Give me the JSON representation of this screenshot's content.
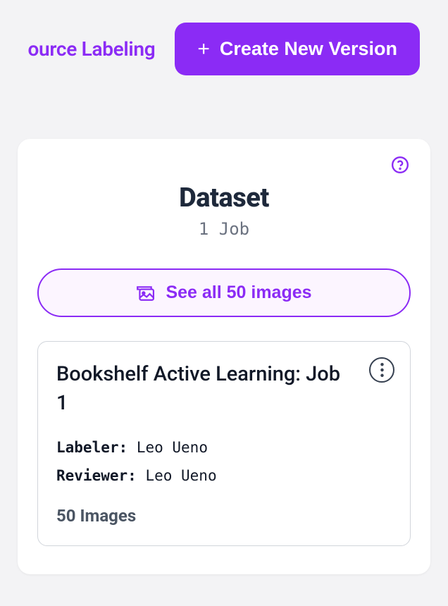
{
  "header": {
    "source_labeling": "ource Labeling",
    "create_button": "Create New Version"
  },
  "card": {
    "title": "Dataset",
    "subtitle": "1 Job",
    "see_all_button": "See all 50 images"
  },
  "job": {
    "title": "Bookshelf Active Learning: Job 1",
    "labeler_label": "Labeler:",
    "labeler_name": "Leo Ueno",
    "reviewer_label": "Reviewer:",
    "reviewer_name": "Leo Ueno",
    "image_count": "50 Images"
  }
}
